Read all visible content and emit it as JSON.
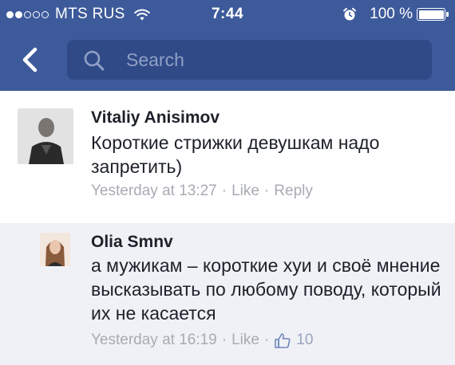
{
  "status_bar": {
    "carrier": "MTS RUS",
    "time": "7:44",
    "battery_percent": "100 %",
    "signal_bars_filled": 2,
    "signal_bars_total": 5
  },
  "nav": {
    "search_placeholder": "Search",
    "icons": {
      "back": "chevron-left-icon",
      "search": "search-icon"
    }
  },
  "colors": {
    "header": "#3d5a9a",
    "search_field": "#2f4a87",
    "meta_text": "#a8abb3",
    "reply_bg": "#eff1f6"
  },
  "comments": [
    {
      "author": "Vitaliy Anisimov",
      "text": "Короткие стрижки девушкам надо запретить)",
      "timestamp": "Yesterday at 13:27",
      "separator": "·",
      "like_label": "Like",
      "reply_label": "Reply"
    },
    {
      "author": "Olia Smnv",
      "text": "а мужикам – короткие хуи и своё мнение высказывать по любому поводу, который их не касается",
      "timestamp": "Yesterday at 16:19",
      "separator": "·",
      "like_label": "Like",
      "like_count": "10"
    }
  ]
}
